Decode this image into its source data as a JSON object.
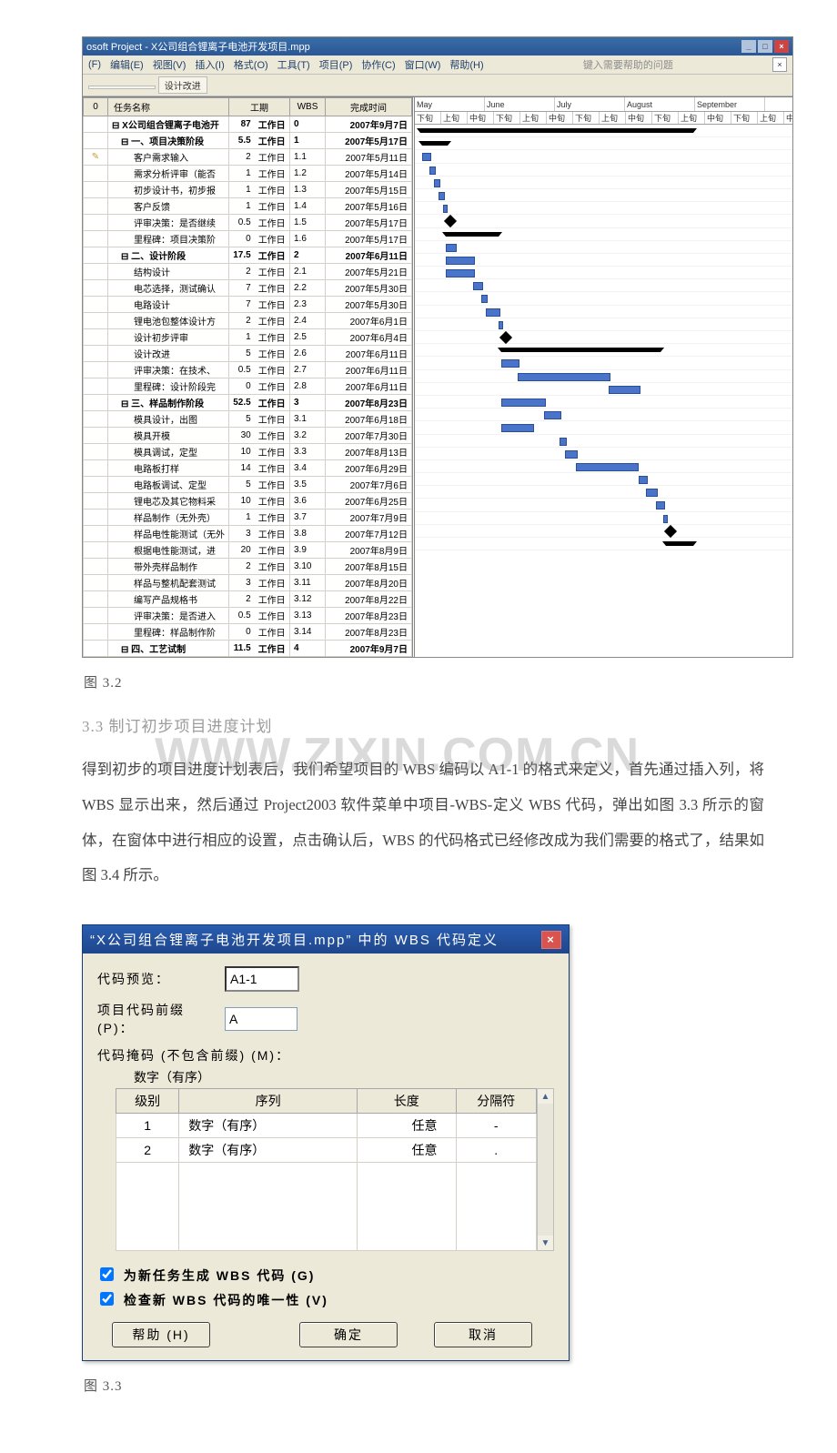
{
  "project_window": {
    "title": "osoft Project - X公司组合锂离子电池开发项目.mpp",
    "menu": [
      "(F)",
      "编辑(E)",
      "视图(V)",
      "插入(I)",
      "格式(O)",
      "工具(T)",
      "项目(P)",
      "协作(C)",
      "窗口(W)",
      "帮助(H)"
    ],
    "help_hint": "键入需要帮助的问题",
    "tracking_label": "设计改进",
    "columns": {
      "info": "0",
      "name": "任务名称",
      "duration": "工期",
      "wbs": "WBS",
      "finish": "完成时间"
    },
    "timescale_top": [
      "May",
      "June",
      "July",
      "August",
      "September"
    ],
    "timescale_bot": [
      "下旬",
      "上旬",
      "中旬",
      "下旬",
      "上旬",
      "中旬",
      "下旬",
      "上旬",
      "中旬",
      "下旬",
      "上旬",
      "中旬",
      "下旬",
      "上旬",
      "中旬"
    ],
    "tasks": [
      {
        "lvl": 0,
        "icon": "",
        "name": "X公司组合锂离子电池开",
        "dur": "87",
        "unit": "工作日",
        "wbs": "0",
        "fin": "2007年9月7日",
        "b": 1,
        "barStart": 6,
        "barLen": 300,
        "type": "summary"
      },
      {
        "lvl": 1,
        "icon": "",
        "name": "一、项目决策阶段",
        "dur": "5.5",
        "unit": "工作日",
        "wbs": "1",
        "fin": "2007年5月17日",
        "b": 1,
        "barStart": 8,
        "barLen": 28,
        "type": "summary"
      },
      {
        "lvl": 2,
        "icon": "note",
        "name": "客户需求输入",
        "dur": "2",
        "unit": "工作日",
        "wbs": "1.1",
        "fin": "2007年5月11日",
        "barStart": 8,
        "barLen": 8,
        "type": "task"
      },
      {
        "lvl": 2,
        "name": "需求分析评审（能否",
        "dur": "1",
        "unit": "工作日",
        "wbs": "1.2",
        "fin": "2007年5月14日",
        "barStart": 16,
        "barLen": 5,
        "type": "task"
      },
      {
        "lvl": 2,
        "name": "初步设计书，初步报",
        "dur": "1",
        "unit": "工作日",
        "wbs": "1.3",
        "fin": "2007年5月15日",
        "barStart": 21,
        "barLen": 5,
        "type": "task"
      },
      {
        "lvl": 2,
        "name": "客户反馈",
        "dur": "1",
        "unit": "工作日",
        "wbs": "1.4",
        "fin": "2007年5月16日",
        "barStart": 26,
        "barLen": 5,
        "type": "task"
      },
      {
        "lvl": 2,
        "name": "评审决策：是否继续",
        "dur": "0.5",
        "unit": "工作日",
        "wbs": "1.5",
        "fin": "2007年5月17日",
        "barStart": 31,
        "barLen": 3,
        "type": "task"
      },
      {
        "lvl": 2,
        "name": "里程碑：项目决策阶",
        "dur": "0",
        "unit": "工作日",
        "wbs": "1.6",
        "fin": "2007年5月17日",
        "barStart": 34,
        "barLen": 0,
        "type": "ms"
      },
      {
        "lvl": 1,
        "name": "二、设计阶段",
        "dur": "17.5",
        "unit": "工作日",
        "wbs": "2",
        "fin": "2007年6月11日",
        "b": 1,
        "barStart": 34,
        "barLen": 58,
        "type": "summary"
      },
      {
        "lvl": 2,
        "name": "结构设计",
        "dur": "2",
        "unit": "工作日",
        "wbs": "2.1",
        "fin": "2007年5月21日",
        "barStart": 34,
        "barLen": 10,
        "type": "task"
      },
      {
        "lvl": 2,
        "name": "电芯选择，测试确认",
        "dur": "7",
        "unit": "工作日",
        "wbs": "2.2",
        "fin": "2007年5月30日",
        "barStart": 34,
        "barLen": 30,
        "type": "task"
      },
      {
        "lvl": 2,
        "name": "电路设计",
        "dur": "7",
        "unit": "工作日",
        "wbs": "2.3",
        "fin": "2007年5月30日",
        "barStart": 34,
        "barLen": 30,
        "type": "task"
      },
      {
        "lvl": 2,
        "name": "锂电池包整体设计方",
        "dur": "2",
        "unit": "工作日",
        "wbs": "2.4",
        "fin": "2007年6月1日",
        "barStart": 64,
        "barLen": 9,
        "type": "task"
      },
      {
        "lvl": 2,
        "name": "设计初步评审",
        "dur": "1",
        "unit": "工作日",
        "wbs": "2.5",
        "fin": "2007年6月4日",
        "barStart": 73,
        "barLen": 5,
        "type": "task"
      },
      {
        "lvl": 2,
        "name": "设计改进",
        "dur": "5",
        "unit": "工作日",
        "wbs": "2.6",
        "fin": "2007年6月11日",
        "barStart": 78,
        "barLen": 14,
        "type": "task"
      },
      {
        "lvl": 2,
        "name": "评审决策：在技术、",
        "dur": "0.5",
        "unit": "工作日",
        "wbs": "2.7",
        "fin": "2007年6月11日",
        "barStart": 92,
        "barLen": 3,
        "type": "task"
      },
      {
        "lvl": 2,
        "name": "里程碑：设计阶段完",
        "dur": "0",
        "unit": "工作日",
        "wbs": "2.8",
        "fin": "2007年6月11日",
        "barStart": 95,
        "barLen": 0,
        "type": "ms"
      },
      {
        "lvl": 1,
        "name": "三、样品制作阶段",
        "dur": "52.5",
        "unit": "工作日",
        "wbs": "3",
        "fin": "2007年8月23日",
        "b": 1,
        "barStart": 95,
        "barLen": 175,
        "type": "summary"
      },
      {
        "lvl": 2,
        "name": "模具设计，出图",
        "dur": "5",
        "unit": "工作日",
        "wbs": "3.1",
        "fin": "2007年6月18日",
        "barStart": 95,
        "barLen": 18,
        "type": "task"
      },
      {
        "lvl": 2,
        "name": "模具开模",
        "dur": "30",
        "unit": "工作日",
        "wbs": "3.2",
        "fin": "2007年7月30日",
        "barStart": 113,
        "barLen": 100,
        "type": "task"
      },
      {
        "lvl": 2,
        "name": "模具调试，定型",
        "dur": "10",
        "unit": "工作日",
        "wbs": "3.3",
        "fin": "2007年8月13日",
        "barStart": 213,
        "barLen": 33,
        "type": "task"
      },
      {
        "lvl": 2,
        "name": "电路板打样",
        "dur": "14",
        "unit": "工作日",
        "wbs": "3.4",
        "fin": "2007年6月29日",
        "barStart": 95,
        "barLen": 47,
        "type": "task"
      },
      {
        "lvl": 2,
        "name": "电路板调试、定型",
        "dur": "5",
        "unit": "工作日",
        "wbs": "3.5",
        "fin": "2007年7月6日",
        "barStart": 142,
        "barLen": 17,
        "type": "task"
      },
      {
        "lvl": 2,
        "name": "锂电芯及其它物料采",
        "dur": "10",
        "unit": "工作日",
        "wbs": "3.6",
        "fin": "2007年6月25日",
        "barStart": 95,
        "barLen": 34,
        "type": "task"
      },
      {
        "lvl": 2,
        "name": "样品制作（无外壳）",
        "dur": "1",
        "unit": "工作日",
        "wbs": "3.7",
        "fin": "2007年7月9日",
        "barStart": 159,
        "barLen": 6,
        "type": "task"
      },
      {
        "lvl": 2,
        "name": "样品电性能测试（无外",
        "dur": "3",
        "unit": "工作日",
        "wbs": "3.8",
        "fin": "2007年7月12日",
        "barStart": 165,
        "barLen": 12,
        "type": "task"
      },
      {
        "lvl": 2,
        "name": "根据电性能测试，进",
        "dur": "20",
        "unit": "工作日",
        "wbs": "3.9",
        "fin": "2007年8月9日",
        "barStart": 177,
        "barLen": 67,
        "type": "task"
      },
      {
        "lvl": 2,
        "name": "带外壳样品制作",
        "dur": "2",
        "unit": "工作日",
        "wbs": "3.10",
        "fin": "2007年8月15日",
        "barStart": 246,
        "barLen": 8,
        "type": "task"
      },
      {
        "lvl": 2,
        "name": "样品与整机配套测试",
        "dur": "3",
        "unit": "工作日",
        "wbs": "3.11",
        "fin": "2007年8月20日",
        "barStart": 254,
        "barLen": 11,
        "type": "task"
      },
      {
        "lvl": 2,
        "name": "编写产品规格书",
        "dur": "2",
        "unit": "工作日",
        "wbs": "3.12",
        "fin": "2007年8月22日",
        "barStart": 265,
        "barLen": 8,
        "type": "task"
      },
      {
        "lvl": 2,
        "name": "评审决策：是否进入",
        "dur": "0.5",
        "unit": "工作日",
        "wbs": "3.13",
        "fin": "2007年8月23日",
        "barStart": 273,
        "barLen": 3,
        "type": "task"
      },
      {
        "lvl": 2,
        "name": "里程碑：样品制作阶",
        "dur": "0",
        "unit": "工作日",
        "wbs": "3.14",
        "fin": "2007年8月23日",
        "barStart": 276,
        "barLen": 0,
        "type": "ms"
      },
      {
        "lvl": 1,
        "name": "四、工艺试制",
        "dur": "11.5",
        "unit": "工作日",
        "wbs": "4",
        "fin": "2007年9月7日",
        "b": 1,
        "barStart": 276,
        "barLen": 30,
        "type": "summary"
      }
    ]
  },
  "caption_3_2": "图 3.2",
  "section_3_3": "3.3   制订初步项目进度计划",
  "watermark": "WWW.ZIXIN.COM.CN",
  "para_text": "得到初步的项目进度计划表后，我们希望项目的 WBS 编码以 A1-1 的格式来定义，首先通过插入列，将 WBS 显示出来，然后通过 Project2003 软件菜单中项目-WBS-定义 WBS 代码，弹出如图 3.3 所示的窗体，在窗体中进行相应的设置，点击确认后，WBS 的代码格式已经修改成为我们需要的格式了，结果如图 3.4 所示。",
  "dlg": {
    "title_prefix": "“X公司组合锂离子电池开发项目.mpp” 中的  WBS  代码定义",
    "code_preview_label": "代码预览：",
    "code_preview_value": "A1-1",
    "prefix_label": "项目代码前缀 (P)：",
    "prefix_value": "A",
    "mask_label": "代码掩码 (不包含前缀) (M)：",
    "mask_sub": "数字（有序）",
    "mask_headers": [
      "级别",
      "序列",
      "长度",
      "分隔符"
    ],
    "mask_rows": [
      {
        "level": "1",
        "seq": "数字（有序）",
        "len": "任意",
        "sep": "-"
      },
      {
        "level": "2",
        "seq": "数字（有序）",
        "len": "任意",
        "sep": "."
      }
    ],
    "cb1": "为新任务生成 WBS 代码 (G)",
    "cb2": "检查新 WBS 代码的唯一性 (V)",
    "help": "帮助 (H)",
    "ok": "确定",
    "cancel": "取消"
  },
  "caption_3_3": "图 3.3"
}
